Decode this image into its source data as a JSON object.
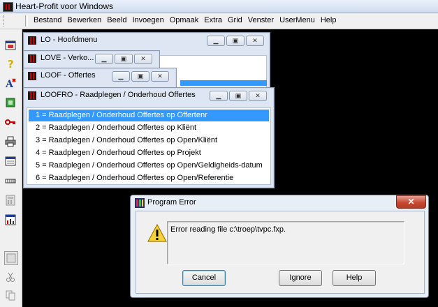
{
  "app": {
    "title": "Heart-Profit voor Windows"
  },
  "menu": [
    "Bestand",
    "Bewerken",
    "Beeld",
    "Invoegen",
    "Opmaak",
    "Extra",
    "Grid",
    "Venster",
    "UserMenu",
    "Help"
  ],
  "toolbar_icons": [
    "window-icon",
    "help-icon",
    "font-icon",
    "exit-icon",
    "key-icon",
    "printer-icon",
    "form-icon",
    "grid-icon",
    "calculator-icon",
    "chart-icon",
    "scissors-icon",
    "copy-icon"
  ],
  "windows": {
    "lo": {
      "title": "LO - Hoofdmenu"
    },
    "love": {
      "title": "LOVE - Verko..."
    },
    "loof": {
      "title": "LOOF - Offertes"
    },
    "loofro": {
      "title": "LOOFRO - Raadplegen / Onderhoud Offertes",
      "items": [
        "1 = Raadplegen / Onderhoud Offertes op Offertenr",
        "2 = Raadplegen / Onderhoud Offertes op Kliënt",
        "3 = Raadplegen / Onderhoud Offertes op Open/Kliënt",
        "4 = Raadplegen / Onderhoud Offertes op Projekt",
        "5 = Raadplegen / Onderhoud Offertes op Open/Geldigheids-datum",
        "6 = Raadplegen / Onderhoud Offertes op Open/Referentie"
      ],
      "selected_index": 0
    }
  },
  "dialog": {
    "title": "Program Error",
    "close_glyph": "✕",
    "message": "Error reading file c:\\troep\\tvpc.fxp.",
    "buttons": {
      "cancel": "Cancel",
      "ignore": "Ignore",
      "help": "Help"
    }
  },
  "colors": {
    "selection": "#3399ff",
    "desktop": "#000000",
    "close_button": "#c74934"
  }
}
